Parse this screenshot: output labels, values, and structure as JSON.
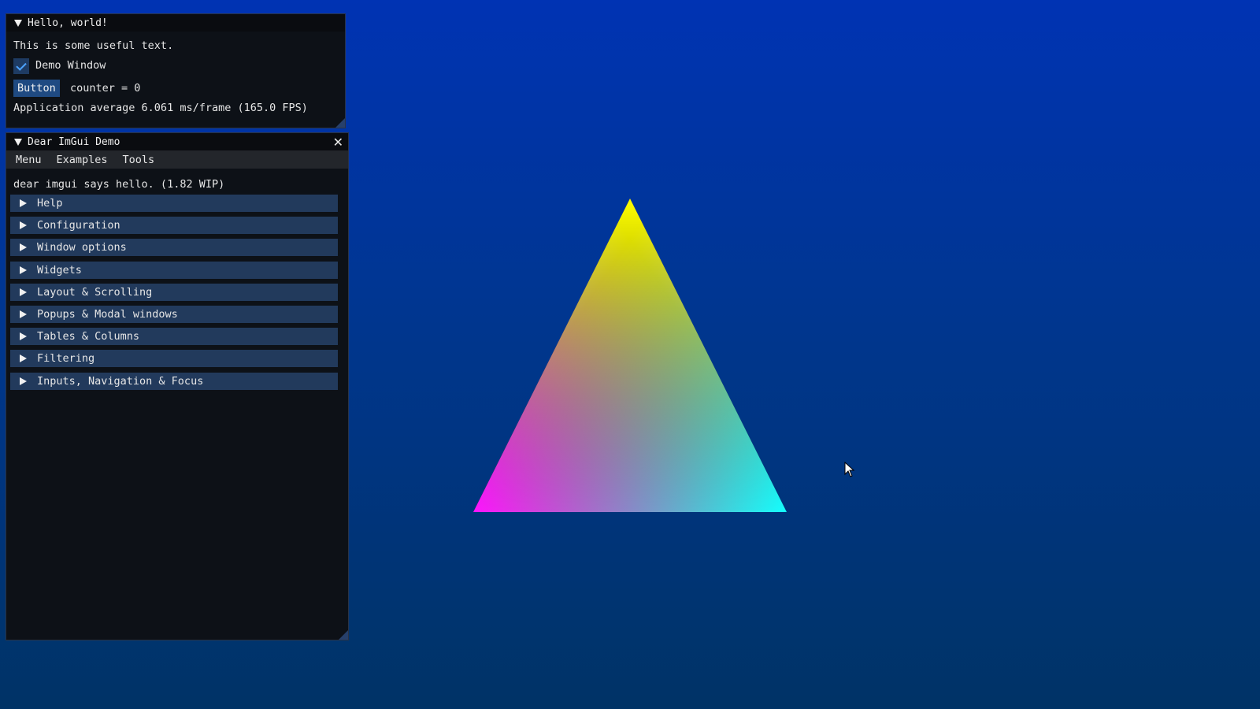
{
  "hello_window": {
    "title": "Hello, world!",
    "text": "This is some useful text.",
    "checkbox_label": "Demo Window",
    "checkbox_checked": true,
    "button_label": "Button",
    "counter_text": "counter = 0",
    "fps_text": "Application average 6.061 ms/frame (165.0 FPS)"
  },
  "demo_window": {
    "title": "Dear ImGui Demo",
    "menu": [
      "Menu",
      "Examples",
      "Tools"
    ],
    "intro": "dear imgui says hello. (1.82 WIP)",
    "headers": [
      "Help",
      "Configuration",
      "Window options",
      "Widgets",
      "Layout & Scrolling",
      "Popups & Modal windows",
      "Tables & Columns",
      "Filtering",
      "Inputs, Navigation & Focus"
    ]
  },
  "colors": {
    "triangle_top": "#ffff00",
    "triangle_left": "#ff00ff",
    "triangle_right": "#00ffff",
    "background_top": "#0033b3",
    "background_bottom": "#003366",
    "header_bg": "#223a5c"
  },
  "icons": {
    "collapse": "collapse-arrow-icon",
    "close": "close-icon",
    "tree_node": "tree-arrow-icon",
    "checkmark": "checkmark-icon",
    "cursor": "mouse-cursor-icon"
  }
}
